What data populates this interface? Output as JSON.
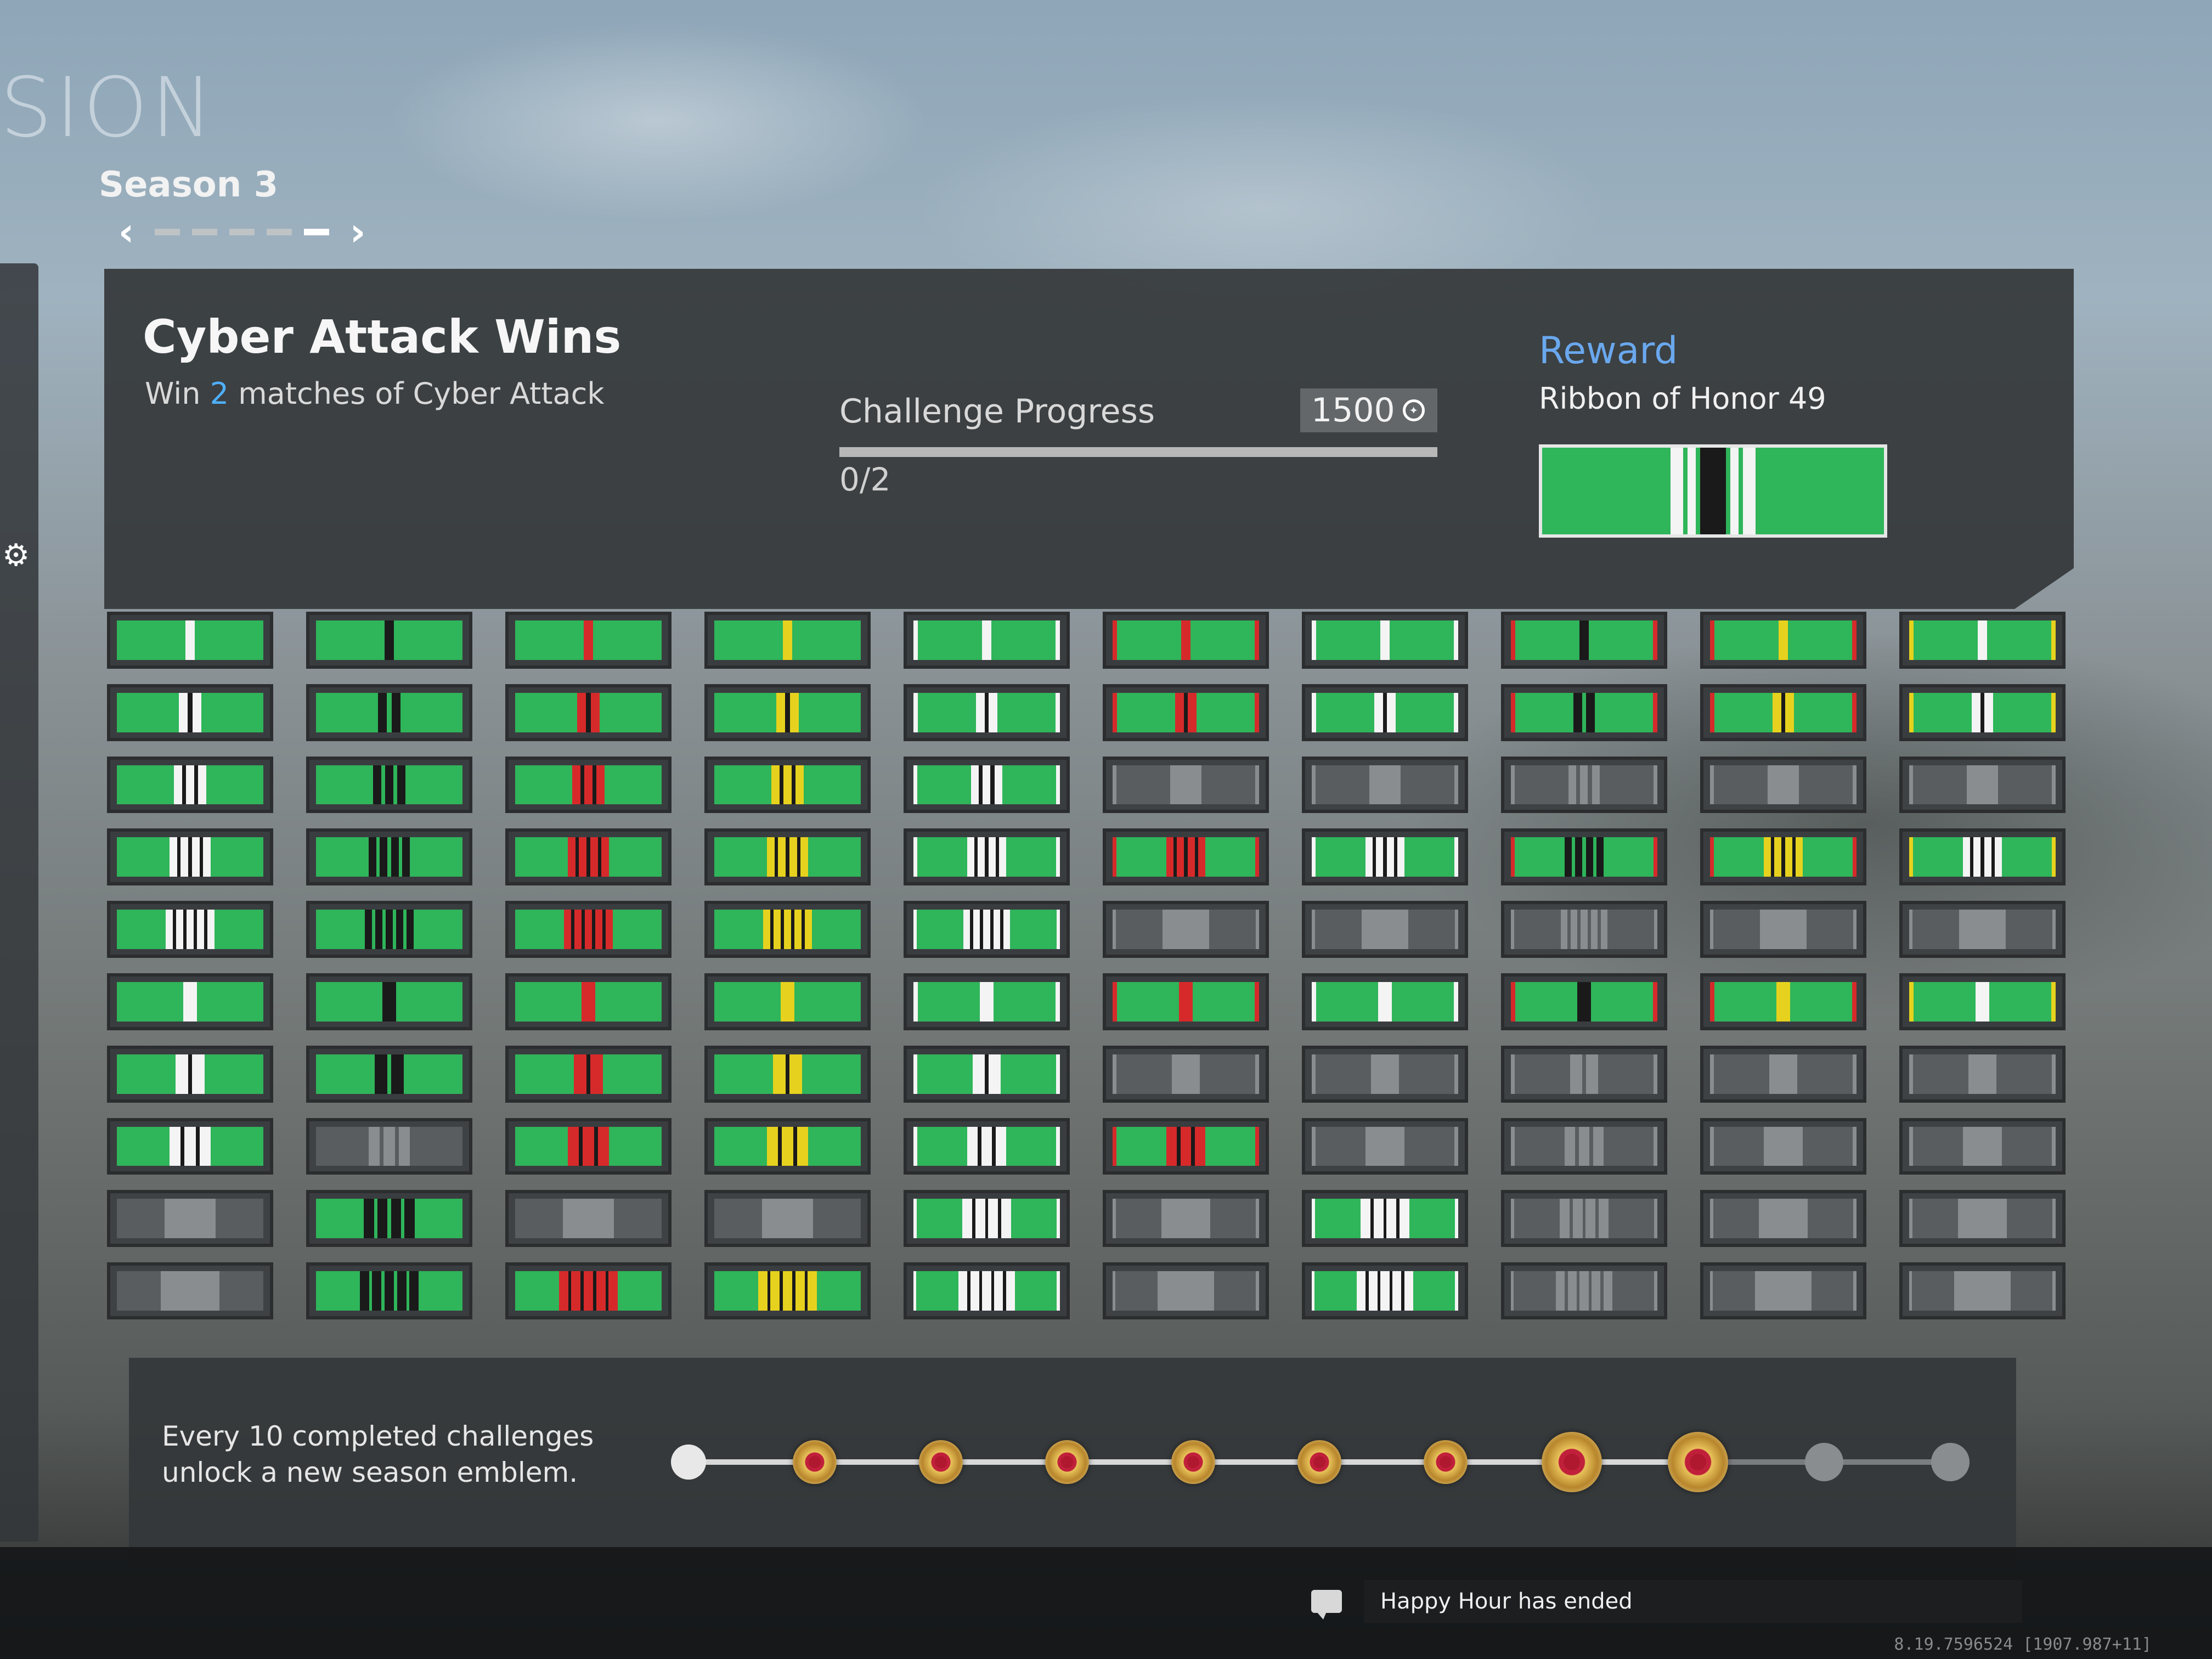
{
  "mode_title": "SION",
  "season": {
    "label": "Season 3",
    "pages": 5,
    "active_page": 5
  },
  "challenge": {
    "title": "Cyber Attack Wins",
    "description_prefix": "Win ",
    "description_highlight": "2",
    "description_suffix": " matches of Cyber Attack",
    "progress_label": "Challenge Progress",
    "xp_value": "1500",
    "progress_count": "0/2",
    "progress_fraction": 0
  },
  "reward": {
    "label": "Reward",
    "name": "Ribbon of Honor 49"
  },
  "footer": {
    "line1": "Every 10 completed challenges",
    "line2": "unlock a new season emblem.",
    "emblems_total": 10,
    "emblems_earned": 8
  },
  "notification": {
    "text": "Happy Hour has ended"
  },
  "build_info": "8.19.7596524 [1907.987+11]",
  "colors": {
    "ribbon_green": "#2fb55a",
    "stripe_white": "#f4f4f4",
    "stripe_black": "#1a1a1a",
    "stripe_red": "#d62a2a",
    "stripe_yellow": "#e6d21e",
    "locked_gray": "#5a5d60",
    "accent_blue": "#4fb0ff"
  },
  "ribbons": {
    "columns": [
      {
        "accent": "white",
        "edge": "none"
      },
      {
        "accent": "black",
        "edge": "none"
      },
      {
        "accent": "red",
        "edge": "none"
      },
      {
        "accent": "yellow",
        "edge": "none"
      },
      {
        "accent": "white",
        "edge": "white"
      },
      {
        "accent": "red",
        "edge": "red"
      },
      {
        "accent": "white",
        "edge": "white"
      },
      {
        "accent": "black",
        "edge": "red"
      },
      {
        "accent": "yellow",
        "edge": "red"
      },
      {
        "accent": "white",
        "edge": "yellow"
      }
    ],
    "locked": [
      [
        9,
        0
      ],
      [
        9,
        9
      ],
      [
        7,
        1
      ],
      [
        8,
        0
      ],
      [
        8,
        2
      ],
      [
        8,
        3
      ],
      [
        8,
        5
      ],
      [
        8,
        7
      ],
      [
        8,
        8
      ],
      [
        8,
        9
      ],
      [
        2,
        5
      ],
      [
        2,
        6
      ],
      [
        2,
        8
      ],
      [
        2,
        9
      ],
      [
        7,
        6
      ],
      [
        7,
        7
      ],
      [
        7,
        8
      ],
      [
        7,
        9
      ],
      [
        4,
        7
      ],
      [
        4,
        8
      ],
      [
        4,
        9
      ],
      [
        6,
        7
      ],
      [
        6,
        8
      ],
      [
        6,
        9
      ],
      [
        9,
        5
      ],
      [
        9,
        7
      ],
      [
        9,
        8
      ],
      [
        6,
        5
      ],
      [
        6,
        6
      ],
      [
        4,
        5
      ],
      [
        4,
        6
      ],
      [
        2,
        7
      ],
      [
        2,
        8
      ]
    ]
  }
}
